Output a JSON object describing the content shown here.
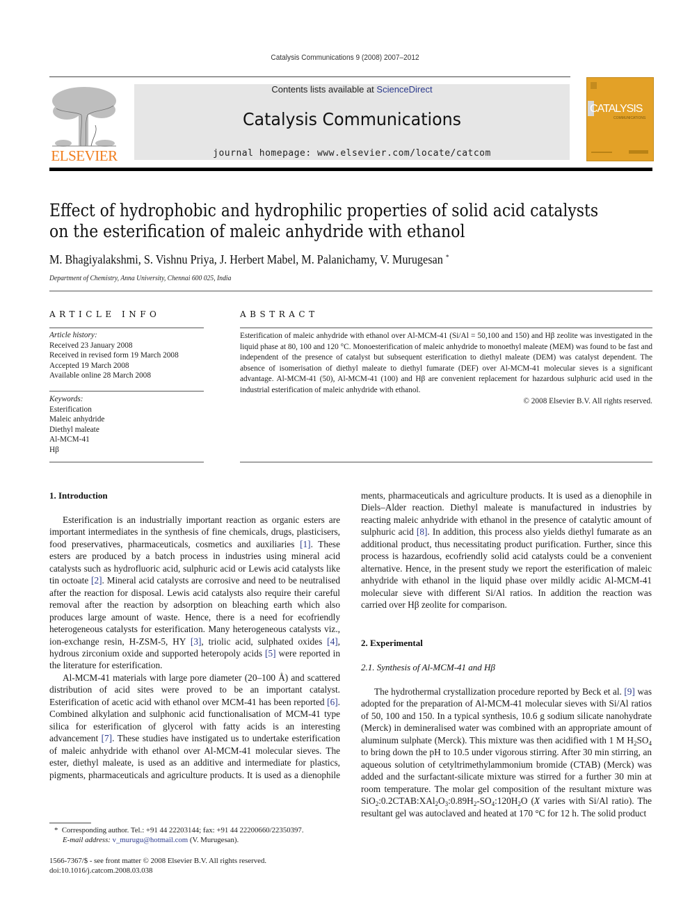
{
  "running_head": "Catalysis Communications 9 (2008) 2007–2012",
  "masthead": {
    "contents_prefix": "Contents lists available at ",
    "contents_link": "ScienceDirect",
    "journal_name": "Catalysis Communications",
    "homepage": "journal homepage: www.elsevier.com/locate/catcom",
    "publisher_logo_text": "ELSEVIER",
    "cover_title": "CATALYSIS",
    "cover_subtitle": "COMMUNICATIONS",
    "colors": {
      "elsevier_orange": "#f07d1c",
      "cover_gold": "#e3a127",
      "link_blue": "#2b3a8c",
      "masthead_gray": "#e6e6e6"
    }
  },
  "article": {
    "title_line1": "Effect of hydrophobic and hydrophilic properties of solid acid catalysts",
    "title_line2": "on the esterification of maleic anhydride with ethanol",
    "authors": "M. Bhagiyalakshmi, S. Vishnu Priya, J. Herbert Mabel, M. Palanichamy, V. Murugesan",
    "author_mark": "*",
    "affiliation": "Department of Chemistry, Anna University, Chennai 600 025, India"
  },
  "article_info": {
    "heading": "ARTICLE INFO",
    "history_label": "Article history:",
    "history": [
      "Received 23 January 2008",
      "Received in revised form 19 March 2008",
      "Accepted 19 March 2008",
      "Available online 28 March 2008"
    ],
    "keywords_label": "Keywords:",
    "keywords": [
      "Esterification",
      "Maleic anhydride",
      "Diethyl maleate",
      "Al-MCM-41",
      "Hβ"
    ]
  },
  "abstract": {
    "heading": "ABSTRACT",
    "text": "Esterification of maleic anhydride with ethanol over Al-MCM-41 (Si/Al = 50,100 and 150) and Hβ zeolite was investigated in the liquid phase at 80, 100 and 120 °C. Monoesterification of maleic anhydride to monoethyl maleate (MEM) was found to be fast and independent of the presence of catalyst but subsequent esterification to diethyl maleate (DEM) was catalyst dependent. The absence of isomerisation of diethyl maleate to diethyl fumarate (DEF) over Al-MCM-41 molecular sieves is a significant advantage. Al-MCM-41 (50), Al-MCM-41 (100) and Hβ are convenient replacement for hazardous sulphuric acid used in the industrial esterification of maleic anhydride with ethanol.",
    "copyright": "© 2008 Elsevier B.V. All rights reserved."
  },
  "intro": {
    "heading": "1.  Introduction",
    "p1": [
      "Esterification is an industrially important reaction as organic esters are important intermediates in the synthesis of fine chemicals, drugs, plasticisers, food preservatives, pharmaceuticals, cosmetics and auxiliaries ",
      "[1]",
      ". These esters are produced by a batch process in industries using mineral acid catalysts such as hydrofluoric acid, sulphuric acid or Lewis acid catalysts like tin octoate ",
      "[2]",
      ". Mineral acid catalysts are corrosive and need to be neutralised after the reaction for disposal. Lewis acid catalysts also require their careful removal after the reaction by adsorption on bleaching earth which also produces large amount of waste. Hence, there is a need for ecofriendly heterogeneous catalysts for esterification. Many heterogeneous catalysts viz., ion-exchange resin, H-ZSM-5, HY ",
      "[3]",
      ", triolic acid, sulphated oxides ",
      "[4]",
      ", hydrous zirconium oxide and supported heteropoly acids ",
      "[5]",
      " were reported in the literature for esterification."
    ],
    "p2": [
      "Al-MCM-41 materials with large pore diameter (20–100 Å) and scattered distribution of acid sites were proved to be an important catalyst. Esterification of acetic acid with ethanol over MCM-41 has been reported ",
      "[6]",
      ". Combined alkylation and sulphonic acid functionalisation of MCM-41 type silica for esterification of glycerol with fatty acids is an interesting advancement ",
      "[7]",
      ". These studies have instigated us to undertake esterification of maleic anhydride with ethanol over Al-MCM-41 molecular sieves. The ester, diethyl maleate, is used as an additive and intermediate for plastics, pigments, pharmaceuticals and agriculture products. It is used as a dienophile in Diels–Alder reaction. Diethyl maleate is manufactured in industries by reacting maleic anhydride with ethanol in the presence of catalytic amount of sulphuric acid ",
      "[8]",
      ". In addition, this process also yields diethyl fumarate as an additional product, thus necessitating product purification. Further, since this process is hazardous, ecofriendly solid acid catalysts could be a convenient alternative. Hence, in the present study we report the esterification of maleic anhydride with ethanol in the liquid phase over mildly acidic Al-MCM-41 molecular sieve with different Si/Al ratios. In addition the reaction was carried over Hβ zeolite for comparison."
    ]
  },
  "experimental": {
    "heading": "2.  Experimental",
    "subheading": "2.1.  Synthesis of Al-MCM-41 and Hβ",
    "p1_a": "The hydrothermal crystallization procedure reported by Beck et al. ",
    "p1_ref": "[9]",
    "p1_b": " was adopted for the preparation of Al-MCM-41 molecular sieves with Si/Al ratios of 50, 100 and 150. In a typical synthesis, 10.6 g sodium silicate nanohydrate (Merck) in demineralised water was combined with an appropriate amount of aluminum sulphate (Merck). This mixture was then acidified with 1 M H",
    "p1_c": " to bring down the pH to 10.5 under vigorous stirring. After 30 min stirring, an aqueous solution of cetyltrimethylammonium bromide (CTAB) (Merck) was added and the surfactant-silicate mixture was stirred for a further 30 min at room temperature. The molar gel composition of the resultant mixture was SiO",
    "p1_d": ":0.2CTAB:XAl",
    "p1_e": ":0.89H",
    "p1_f": "-SO",
    "p1_g": ":120H",
    "p1_h": "O (",
    "p1_x": "X",
    "p1_i": " varies with Si/Al ratio). The resultant gel was autoclaved and heated at 170 °C for 12 h. The solid product",
    "sub_2": "2",
    "sub_so4": "SO",
    "sub_4": "4",
    "sub_3": "3"
  },
  "footnote": {
    "mark": "*",
    "line1": "Corresponding author. Tel.: +91 44 22203144; fax: +91 44 22200660/22350397.",
    "email_label": "E-mail address: ",
    "email": "v_murugu@hotmail.com",
    "email_suffix": " (V. Murugesan).",
    "issn": "1566-7367/$ - see front matter © 2008 Elsevier B.V. All rights reserved.",
    "doi": "doi:10.1016/j.catcom.2008.03.038"
  }
}
